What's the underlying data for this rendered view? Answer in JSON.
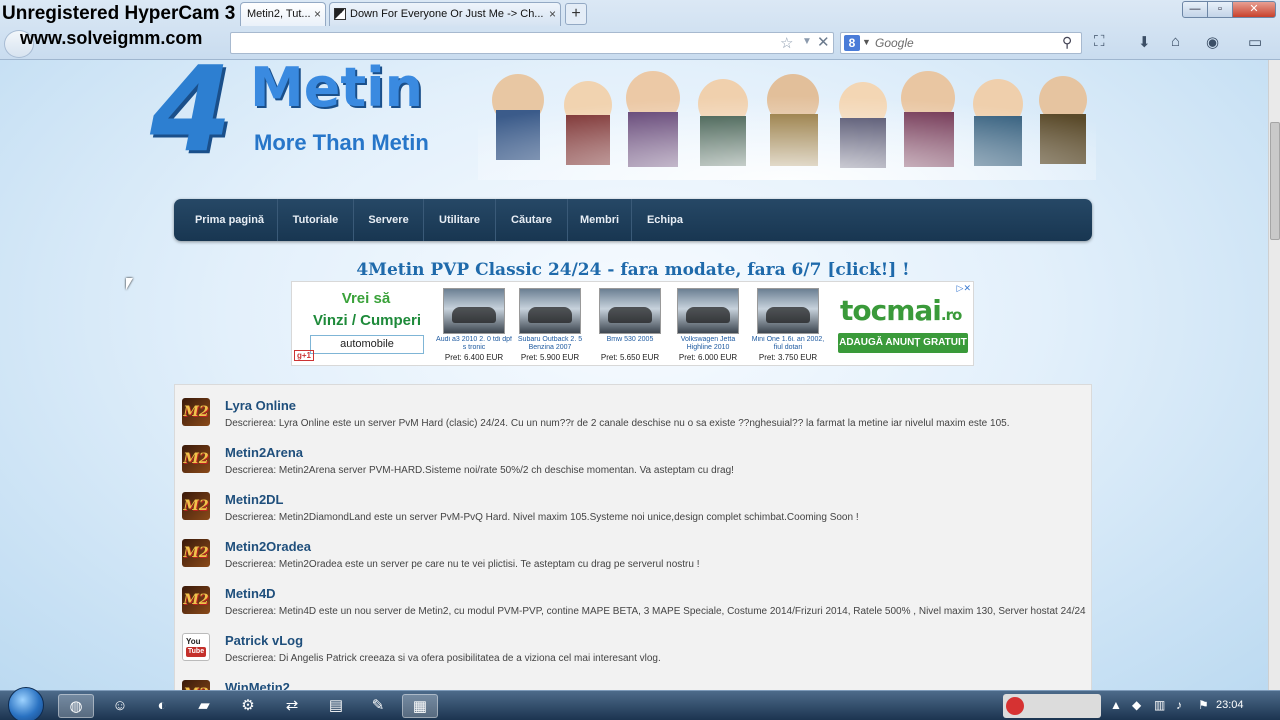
{
  "watermark": {
    "line1": "Unregistered HyperCam 3",
    "line2": "www.solveigmm.com"
  },
  "browser": {
    "tabs": [
      {
        "label": "Metin2, Tut...",
        "active": true
      },
      {
        "label": "Down For Everyone Or Just Me -> Ch...",
        "active": false
      }
    ],
    "new_tab": "+",
    "close_glyph": "×",
    "search_placeholder": "Google",
    "search_engine_glyph": "8",
    "window_controls": {
      "minimize": "—",
      "maximize": "▫",
      "close": "✕"
    }
  },
  "site": {
    "logo_number": "4",
    "logo_word": "Metin",
    "logo_tagline": "More Than Metin",
    "nav": [
      "Prima pagină",
      "Tutoriale",
      "Servere",
      "Utilitare",
      "Căutare",
      "Membri",
      "Echipa"
    ],
    "featured": "4Metin PVP Classic 24/24 - fara modate, fara 6/7 [click!] !"
  },
  "ad": {
    "headline1": "Vrei să",
    "headline2": "Vinzi / Cumperi",
    "input_value": "automobile",
    "gplus": "g+1",
    "brand": "tocmai",
    "brand_suffix": ".ro",
    "cta": "ADAUGĂ ANUNȚ GRATUIT",
    "choices": "▷✕",
    "cars": [
      {
        "name": "Audi a3 2010 2. 0 tdi dpf s tronic",
        "price": "Pret: 6.400 EUR"
      },
      {
        "name": "Subaru Outback 2. 5 Benzina 2007",
        "price": "Pret: 5.900 EUR"
      },
      {
        "name": "Bmw 530 2005",
        "price": "Pret: 5.650 EUR"
      },
      {
        "name": "Volkswagen Jetta Highline 2010",
        "price": "Pret: 6.000 EUR"
      },
      {
        "name": "Mini One 1.6i. an 2002, fiul dotari",
        "price": "Pret: 3.750 EUR"
      }
    ]
  },
  "servers": [
    {
      "icon": "m2",
      "title": "Lyra Online",
      "desc": "Descrierea: Lyra Online este un server PvM Hard (clasic) 24/24. Cu un num??r de 2 canale deschise nu o sa existe ??nghesuial?? la farmat la metine iar nivelul maxim este 105."
    },
    {
      "icon": "m2",
      "title": "Metin2Arena",
      "desc": "Descrierea: Metin2Arena server PVM-HARD.Sisteme noi/rate 50%/2 ch deschise momentan. Va asteptam cu drag!"
    },
    {
      "icon": "m2",
      "title": "Metin2DL",
      "desc": "Descrierea: Metin2DiamondLand este un server PvM-PvQ Hard. Nivel maxim 105.Systeme noi unice,design complet schimbat.Cooming Soon !"
    },
    {
      "icon": "m2",
      "title": "Metin2Oradea",
      "desc": "Descrierea: Metin2Oradea este un server pe care nu te vei plictisi. Te asteptam cu drag pe serverul nostru !"
    },
    {
      "icon": "m2",
      "title": "Metin4D",
      "desc": "Descrierea: Metin4D este un nou server de Metin2, cu modul PVM-PVP, contine MAPE BETA, 3 MAPE Speciale, Costume 2014/Frizuri 2014, Ratele 500% , Nivel maxim 130, Server hostat 24/24"
    },
    {
      "icon": "youtube",
      "title": "Patrick vLog",
      "desc": "Descrierea: Di Angelis Patrick creeaza si va ofera posibilitatea de a viziona cel mai interesant vlog."
    },
    {
      "icon": "m2",
      "title": "WinMetin2",
      "desc": ""
    }
  ],
  "icon_glyphs": {
    "m2": "M2",
    "youtube_top": "You",
    "youtube_bottom": "Tube"
  },
  "taskbar": {
    "clock": "23:04",
    "apps": [
      "firefox-icon",
      "smiley-icon",
      "media-icon",
      "folder-icon",
      "steam-icon",
      "network-icon",
      "notepad-icon",
      "tool-icon",
      "photo-icon"
    ]
  }
}
